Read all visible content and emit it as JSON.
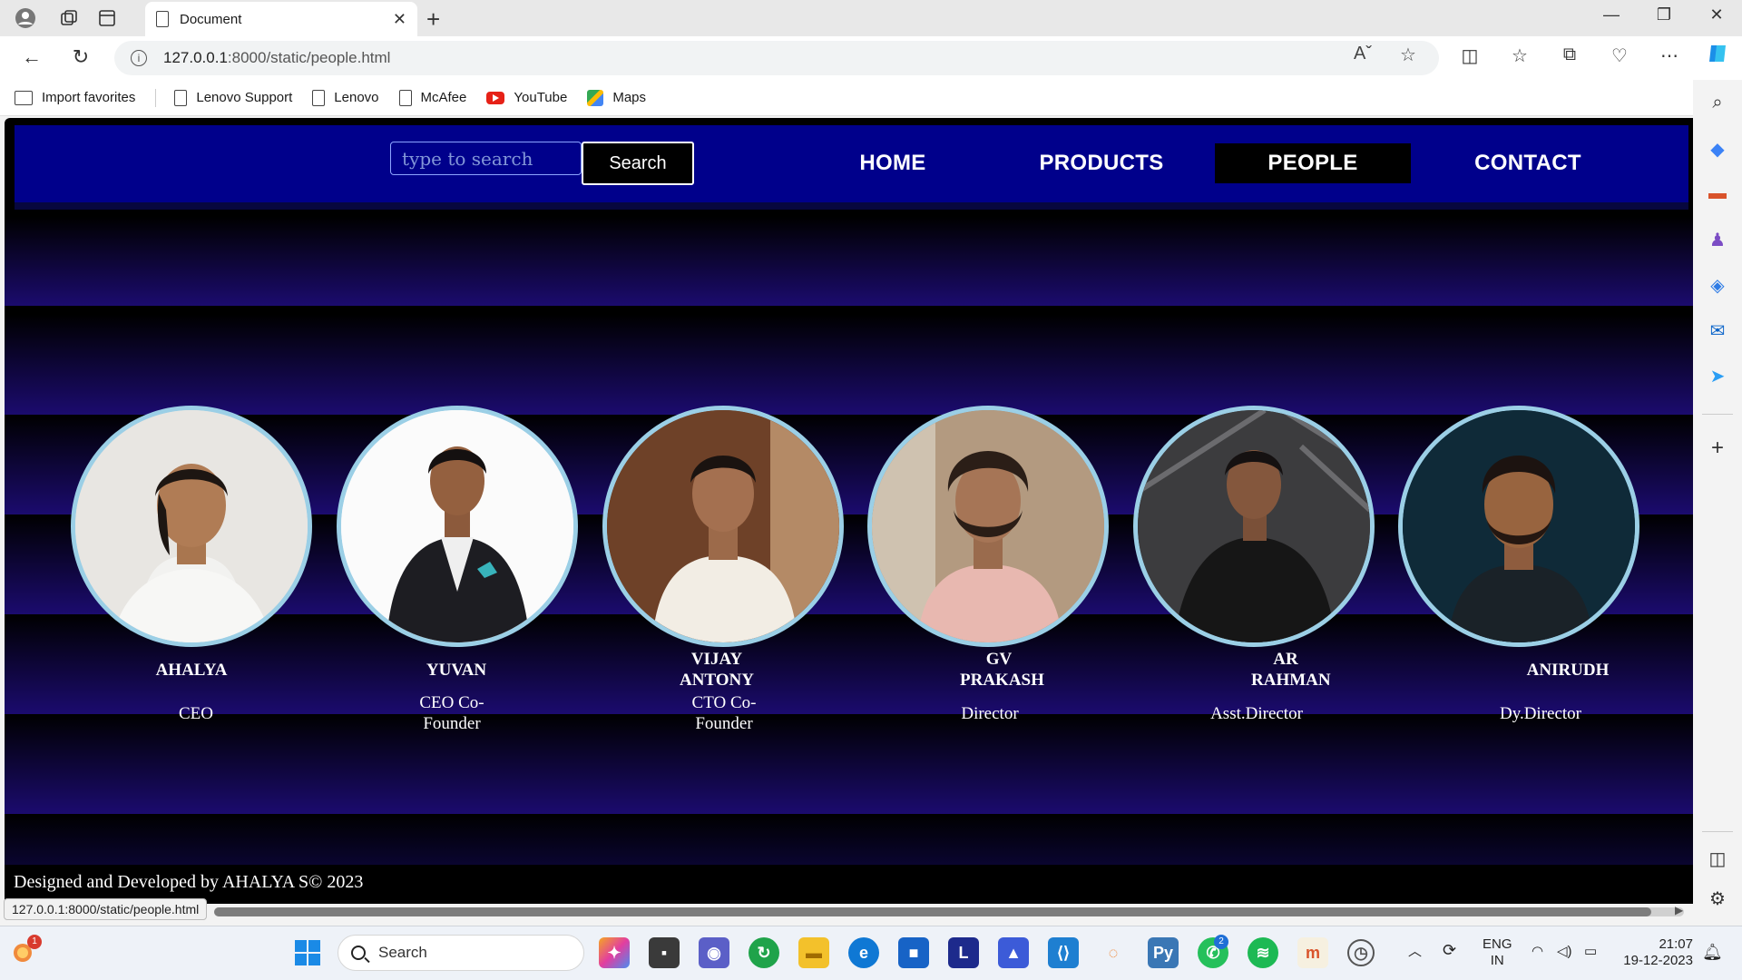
{
  "browser": {
    "tab_title": "Document",
    "url_host": "127.0.0.1",
    "url_path": ":8000/static/people.html",
    "status_url": "127.0.0.1:8000/static/people.html"
  },
  "favorites": [
    {
      "label": "Import favorites",
      "icon": "import-icon"
    },
    {
      "label": "Lenovo Support",
      "icon": "page-icon"
    },
    {
      "label": "Lenovo",
      "icon": "page-icon"
    },
    {
      "label": "McAfee",
      "icon": "page-icon"
    },
    {
      "label": "YouTube",
      "icon": "youtube-icon"
    },
    {
      "label": "Maps",
      "icon": "maps-icon"
    }
  ],
  "site": {
    "search_placeholder": "type to search",
    "search_button": "Search",
    "menu": [
      "HOME",
      "PRODUCTS",
      "PEOPLE",
      "CONTACT"
    ],
    "active_menu": "PEOPLE",
    "people": [
      {
        "name": "AHALYA",
        "role": "CEO"
      },
      {
        "name": "YUVAN",
        "role": "CEO Co-Founder"
      },
      {
        "name": "VIJAY ANTONY",
        "role": "CTO Co-Founder"
      },
      {
        "name": "GV PRAKASH",
        "role": "Director"
      },
      {
        "name": "AR RAHMAN",
        "role": "Asst.Director"
      },
      {
        "name": "ANIRUDH",
        "role": "Dy.Director"
      }
    ],
    "footer": "Designed and Developed by AHALYA S© 2023"
  },
  "taskbar": {
    "search_label": "Search",
    "lang_top": "ENG",
    "lang_bottom": "IN",
    "time": "21:07",
    "date": "19-12-2023",
    "notification_count": "1",
    "whatsapp_count": "2"
  },
  "colors": {
    "nav_bg": "#00008b",
    "accent_border": "#9bcfe6",
    "band_purple": "#1b0b6e"
  }
}
